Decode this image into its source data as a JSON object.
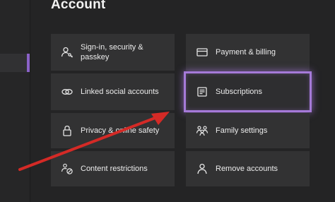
{
  "page": {
    "title": "Account"
  },
  "tiles": {
    "signin": {
      "label": "Sign-in, security & passkey",
      "icon": "person-key-icon"
    },
    "payment": {
      "label": "Payment & billing",
      "icon": "credit-card-icon"
    },
    "linked": {
      "label": "Linked social accounts",
      "icon": "link-icon"
    },
    "subscriptions": {
      "label": "Subscriptions",
      "icon": "receipt-icon"
    },
    "privacy": {
      "label": "Privacy & online safety",
      "icon": "lock-icon"
    },
    "family": {
      "label": "Family settings",
      "icon": "family-icon"
    },
    "content": {
      "label": "Content restrictions",
      "icon": "restricted-person-icon"
    },
    "remove": {
      "label": "Remove accounts",
      "icon": "person-icon"
    }
  },
  "colors": {
    "focus_glow": "#a57ad8",
    "annotation_arrow": "#d42a26",
    "tile_bg": "#323233",
    "page_bg": "#242425"
  }
}
